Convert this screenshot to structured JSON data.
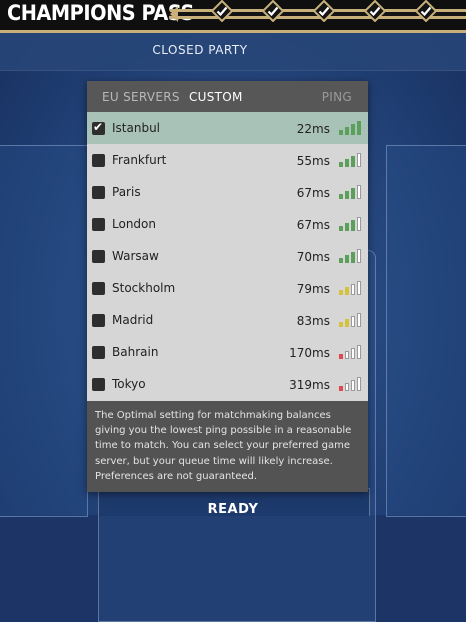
{
  "header": {
    "title": "CHAMPIONS PASS",
    "tier_icon": "check-diamond-icon",
    "tier_count": 5
  },
  "party": {
    "label": "CLOSED PARTY"
  },
  "ready_button": {
    "label": "READY"
  },
  "server_selector": {
    "tabs": [
      {
        "label": "EU SERVERS",
        "active": false
      },
      {
        "label": "CUSTOM",
        "active": true
      }
    ],
    "ping_header": "PING",
    "servers": [
      {
        "name": "Istanbul",
        "ping": "22ms",
        "checked": true,
        "signal_bars": 4,
        "signal_color": "#5aa05a"
      },
      {
        "name": "Frankfurt",
        "ping": "55ms",
        "checked": false,
        "signal_bars": 3,
        "signal_color": "#5aa05a"
      },
      {
        "name": "Paris",
        "ping": "67ms",
        "checked": false,
        "signal_bars": 3,
        "signal_color": "#5aa05a"
      },
      {
        "name": "London",
        "ping": "67ms",
        "checked": false,
        "signal_bars": 3,
        "signal_color": "#5aa05a"
      },
      {
        "name": "Warsaw",
        "ping": "70ms",
        "checked": false,
        "signal_bars": 3,
        "signal_color": "#5aa05a"
      },
      {
        "name": "Stockholm",
        "ping": "79ms",
        "checked": false,
        "signal_bars": 2,
        "signal_color": "#d4c23a"
      },
      {
        "name": "Madrid",
        "ping": "83ms",
        "checked": false,
        "signal_bars": 2,
        "signal_color": "#d4c23a"
      },
      {
        "name": "Bahrain",
        "ping": "170ms",
        "checked": false,
        "signal_bars": 1,
        "signal_color": "#e04a4a"
      },
      {
        "name": "Tokyo",
        "ping": "319ms",
        "checked": false,
        "signal_bars": 1,
        "signal_color": "#e04a4a"
      }
    ],
    "info_text": "The Optimal setting for matchmaking balances giving you the lowest ping possible in a reasonable time to match. You can select your preferred game server, but your queue time will likely increase. Preferences are not guaranteed."
  },
  "colors": {
    "accent_gold": "#c7b07a",
    "selected_row": "#a9c2b8",
    "signal_off": "#ffffff"
  }
}
